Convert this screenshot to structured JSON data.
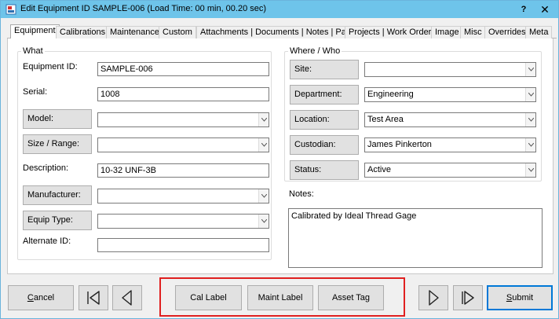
{
  "window": {
    "title": "Edit Equipment ID SAMPLE-006 (Load Time: 00 min, 00.20 sec)",
    "help_label": "?",
    "close_label": "✕"
  },
  "tabs": [
    {
      "label": "Equipment",
      "active": true
    },
    {
      "label": "Calibrations"
    },
    {
      "label": "Maintenance"
    },
    {
      "label": "Custom"
    },
    {
      "label": "Attachments | Documents | Notes | Parts"
    },
    {
      "label": "Projects | Work Orders"
    },
    {
      "label": "Image"
    },
    {
      "label": "Misc"
    },
    {
      "label": "Overrides"
    },
    {
      "label": "Meta"
    }
  ],
  "what": {
    "title": "What",
    "equipment_id": {
      "label": "Equipment ID:",
      "value": "SAMPLE-006"
    },
    "serial": {
      "label": "Serial:",
      "value": "1008"
    },
    "model": {
      "label": "Model:",
      "value": ""
    },
    "size_range": {
      "label": "Size / Range:",
      "value": ""
    },
    "description": {
      "label": "Description:",
      "value": "10-32 UNF-3B"
    },
    "manufacturer": {
      "label": "Manufacturer:",
      "value": ""
    },
    "equip_type": {
      "label": "Equip Type:",
      "value": ""
    },
    "alternate_id": {
      "label": "Alternate ID:",
      "value": ""
    }
  },
  "where_who": {
    "title": "Where / Who",
    "site": {
      "label": "Site:",
      "value": ""
    },
    "department": {
      "label": "Department:",
      "value": "Engineering"
    },
    "location": {
      "label": "Location:",
      "value": "Test Area"
    },
    "custodian": {
      "label": "Custodian:",
      "value": "James Pinkerton"
    },
    "status": {
      "label": "Status:",
      "value": "Active"
    }
  },
  "notes": {
    "label": "Notes:",
    "value": "Calibrated by Ideal Thread Gage"
  },
  "footer": {
    "cancel_prefix": "C",
    "cancel_rest": "ancel",
    "cal_label": "Cal Label",
    "maint_label": "Maint Label",
    "asset_tag": "Asset Tag",
    "submit_prefix": "S",
    "submit_rest": "ubmit"
  },
  "colors": {
    "titlebar": "#6ec4ea",
    "highlight": "#e02020",
    "primary_border": "#0078d7"
  },
  "icons": {
    "first": "skip-first-icon",
    "prev": "previous-icon",
    "next": "next-icon",
    "last": "skip-last-icon",
    "dropdown": "chevron-down-icon"
  }
}
